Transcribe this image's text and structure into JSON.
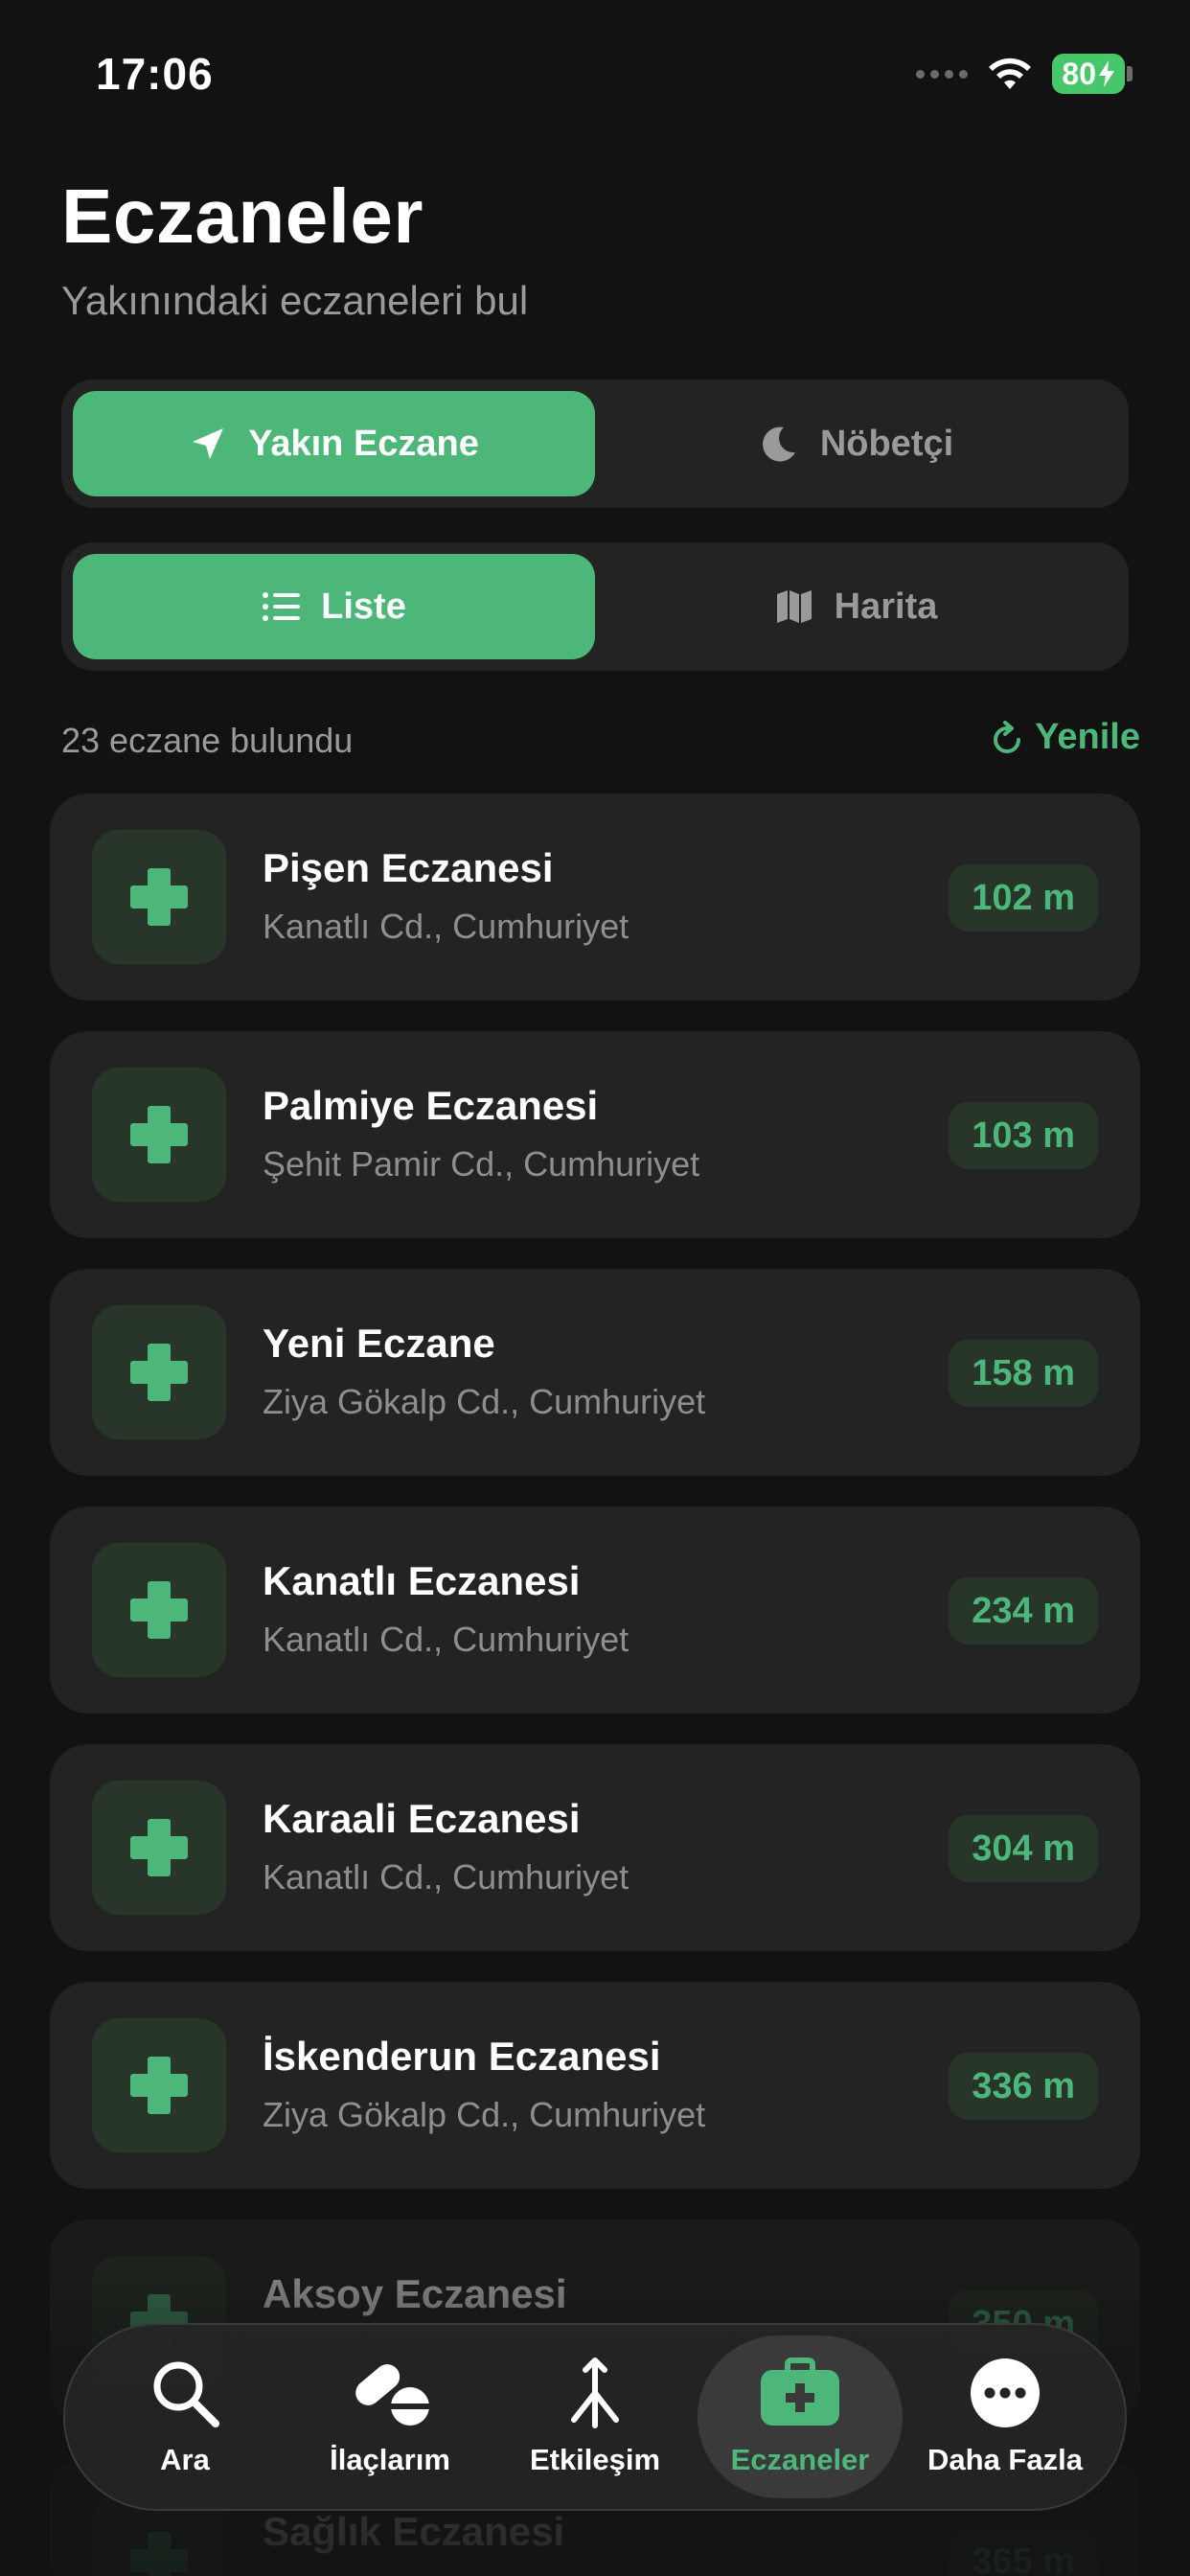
{
  "status_bar": {
    "time": "17:06",
    "battery": "80"
  },
  "header": {
    "title": "Eczaneler",
    "subtitle": "Yakınındaki eczaneleri bul"
  },
  "mode_toggle": {
    "nearby_label": "Yakın Eczane",
    "on_duty_label": "Nöbetçi",
    "selected": "nearby"
  },
  "view_toggle": {
    "list_label": "Liste",
    "map_label": "Harita",
    "selected": "list"
  },
  "results": {
    "count_text": "23 eczane bulundu",
    "refresh_label": "Yenile"
  },
  "pharmacies": [
    {
      "name": "Pişen Eczanesi",
      "address": "Kanatlı Cd., Cumhuriyet",
      "distance": "102 m"
    },
    {
      "name": "Palmiye Eczanesi",
      "address": "Şehit Pamir Cd., Cumhuriyet",
      "distance": "103 m"
    },
    {
      "name": "Yeni Eczane",
      "address": "Ziya Gökalp Cd., Cumhuriyet",
      "distance": "158 m"
    },
    {
      "name": "Kanatlı Eczanesi",
      "address": "Kanatlı Cd., Cumhuriyet",
      "distance": "234 m"
    },
    {
      "name": "Karaali Eczanesi",
      "address": "Kanatlı Cd., Cumhuriyet",
      "distance": "304 m"
    },
    {
      "name": "İskenderun Eczanesi",
      "address": "Ziya Gökalp Cd., Cumhuriyet",
      "distance": "336 m"
    },
    {
      "name": "Aksoy Eczanesi",
      "address": "",
      "distance": "350 m"
    },
    {
      "name": "Sağlık Eczanesi",
      "address": "",
      "distance": "365 m"
    }
  ],
  "tab_bar": {
    "items": [
      {
        "label": "Ara",
        "icon": "search-icon"
      },
      {
        "label": "İlaçlarım",
        "icon": "pills-icon"
      },
      {
        "label": "Etkileşim",
        "icon": "interaction-icon"
      },
      {
        "label": "Eczaneler",
        "icon": "medical-kit-icon"
      },
      {
        "label": "Daha Fazla",
        "icon": "more-icon"
      }
    ],
    "active": "Eczaneler"
  },
  "colors": {
    "accent": "#4cb779",
    "background": "#121212",
    "card": "#232323",
    "icon_bg": "#283529"
  }
}
